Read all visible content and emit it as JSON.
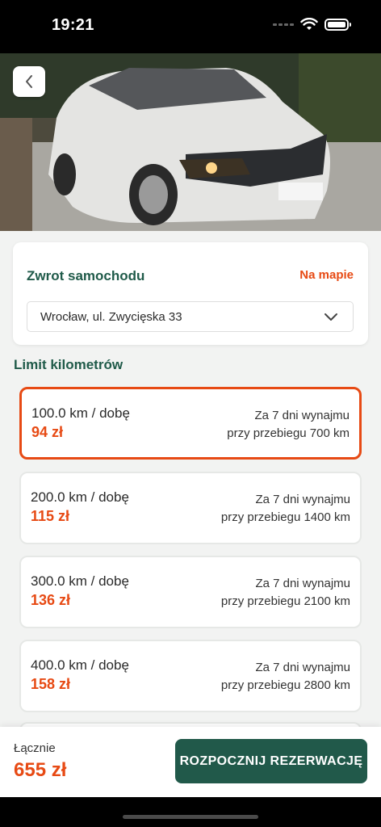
{
  "status_bar": {
    "time": "19:21"
  },
  "return_section": {
    "title": "Zwrot samochodu",
    "map_link": "Na mapie",
    "address": "Wrocław, ul. Zwycięska 33"
  },
  "limit_section": {
    "title": "Limit kilometrów",
    "options": [
      {
        "km": "100.0 km / dobę",
        "price": "94 zł",
        "note1": "Za 7 dni wynajmu",
        "note2": "przy przebiegu 700 km",
        "selected": true
      },
      {
        "km": "200.0 km / dobę",
        "price": "115 zł",
        "note1": "Za 7 dni wynajmu",
        "note2": "przy przebiegu 1400 km",
        "selected": false
      },
      {
        "km": "300.0 km / dobę",
        "price": "136 zł",
        "note1": "Za 7 dni wynajmu",
        "note2": "przy przebiegu 2100 km",
        "selected": false
      },
      {
        "km": "400.0 km / dobę",
        "price": "158 zł",
        "note1": "Za 7 dni wynajmu",
        "note2": "przy przebiegu 2800 km",
        "selected": false
      }
    ]
  },
  "footer": {
    "total_label": "Łącznie",
    "total_value": "655 zł",
    "reserve_button": "ROZPOCZNIJ REZERWACJĘ"
  },
  "colors": {
    "accent_orange": "#e74a14",
    "brand_green": "#21594a"
  },
  "icons": {
    "back": "chevron-left-icon",
    "dropdown": "chevron-down-icon",
    "wifi": "wifi-icon",
    "battery": "battery-icon",
    "signal": "cellular-signal-icon"
  }
}
